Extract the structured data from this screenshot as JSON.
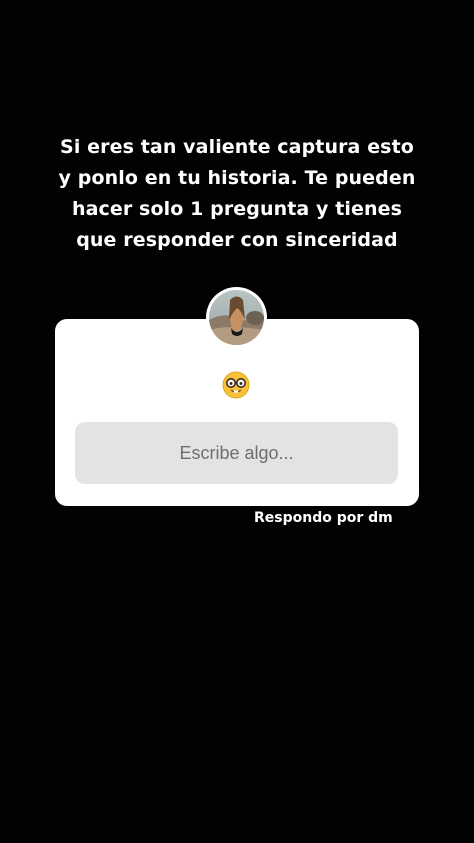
{
  "story": {
    "headline_lines": [
      "Si eres tan valiente captura esto",
      "y ponlo en tu historia. Te pueden",
      "hacer solo 1 pregunta y tienes",
      "que responder con sinceridad"
    ],
    "question_box": {
      "avatar_icon": "profile-photo",
      "emoji_icon": "nerd-face-emoji",
      "input_placeholder": "Escribe algo..."
    },
    "caption": "Respondo por dm"
  },
  "colors": {
    "background": "#020202",
    "card": "#ffffff",
    "input": "#e3e3e3",
    "placeholder": "#6e6e6e",
    "text": "#ffffff"
  }
}
